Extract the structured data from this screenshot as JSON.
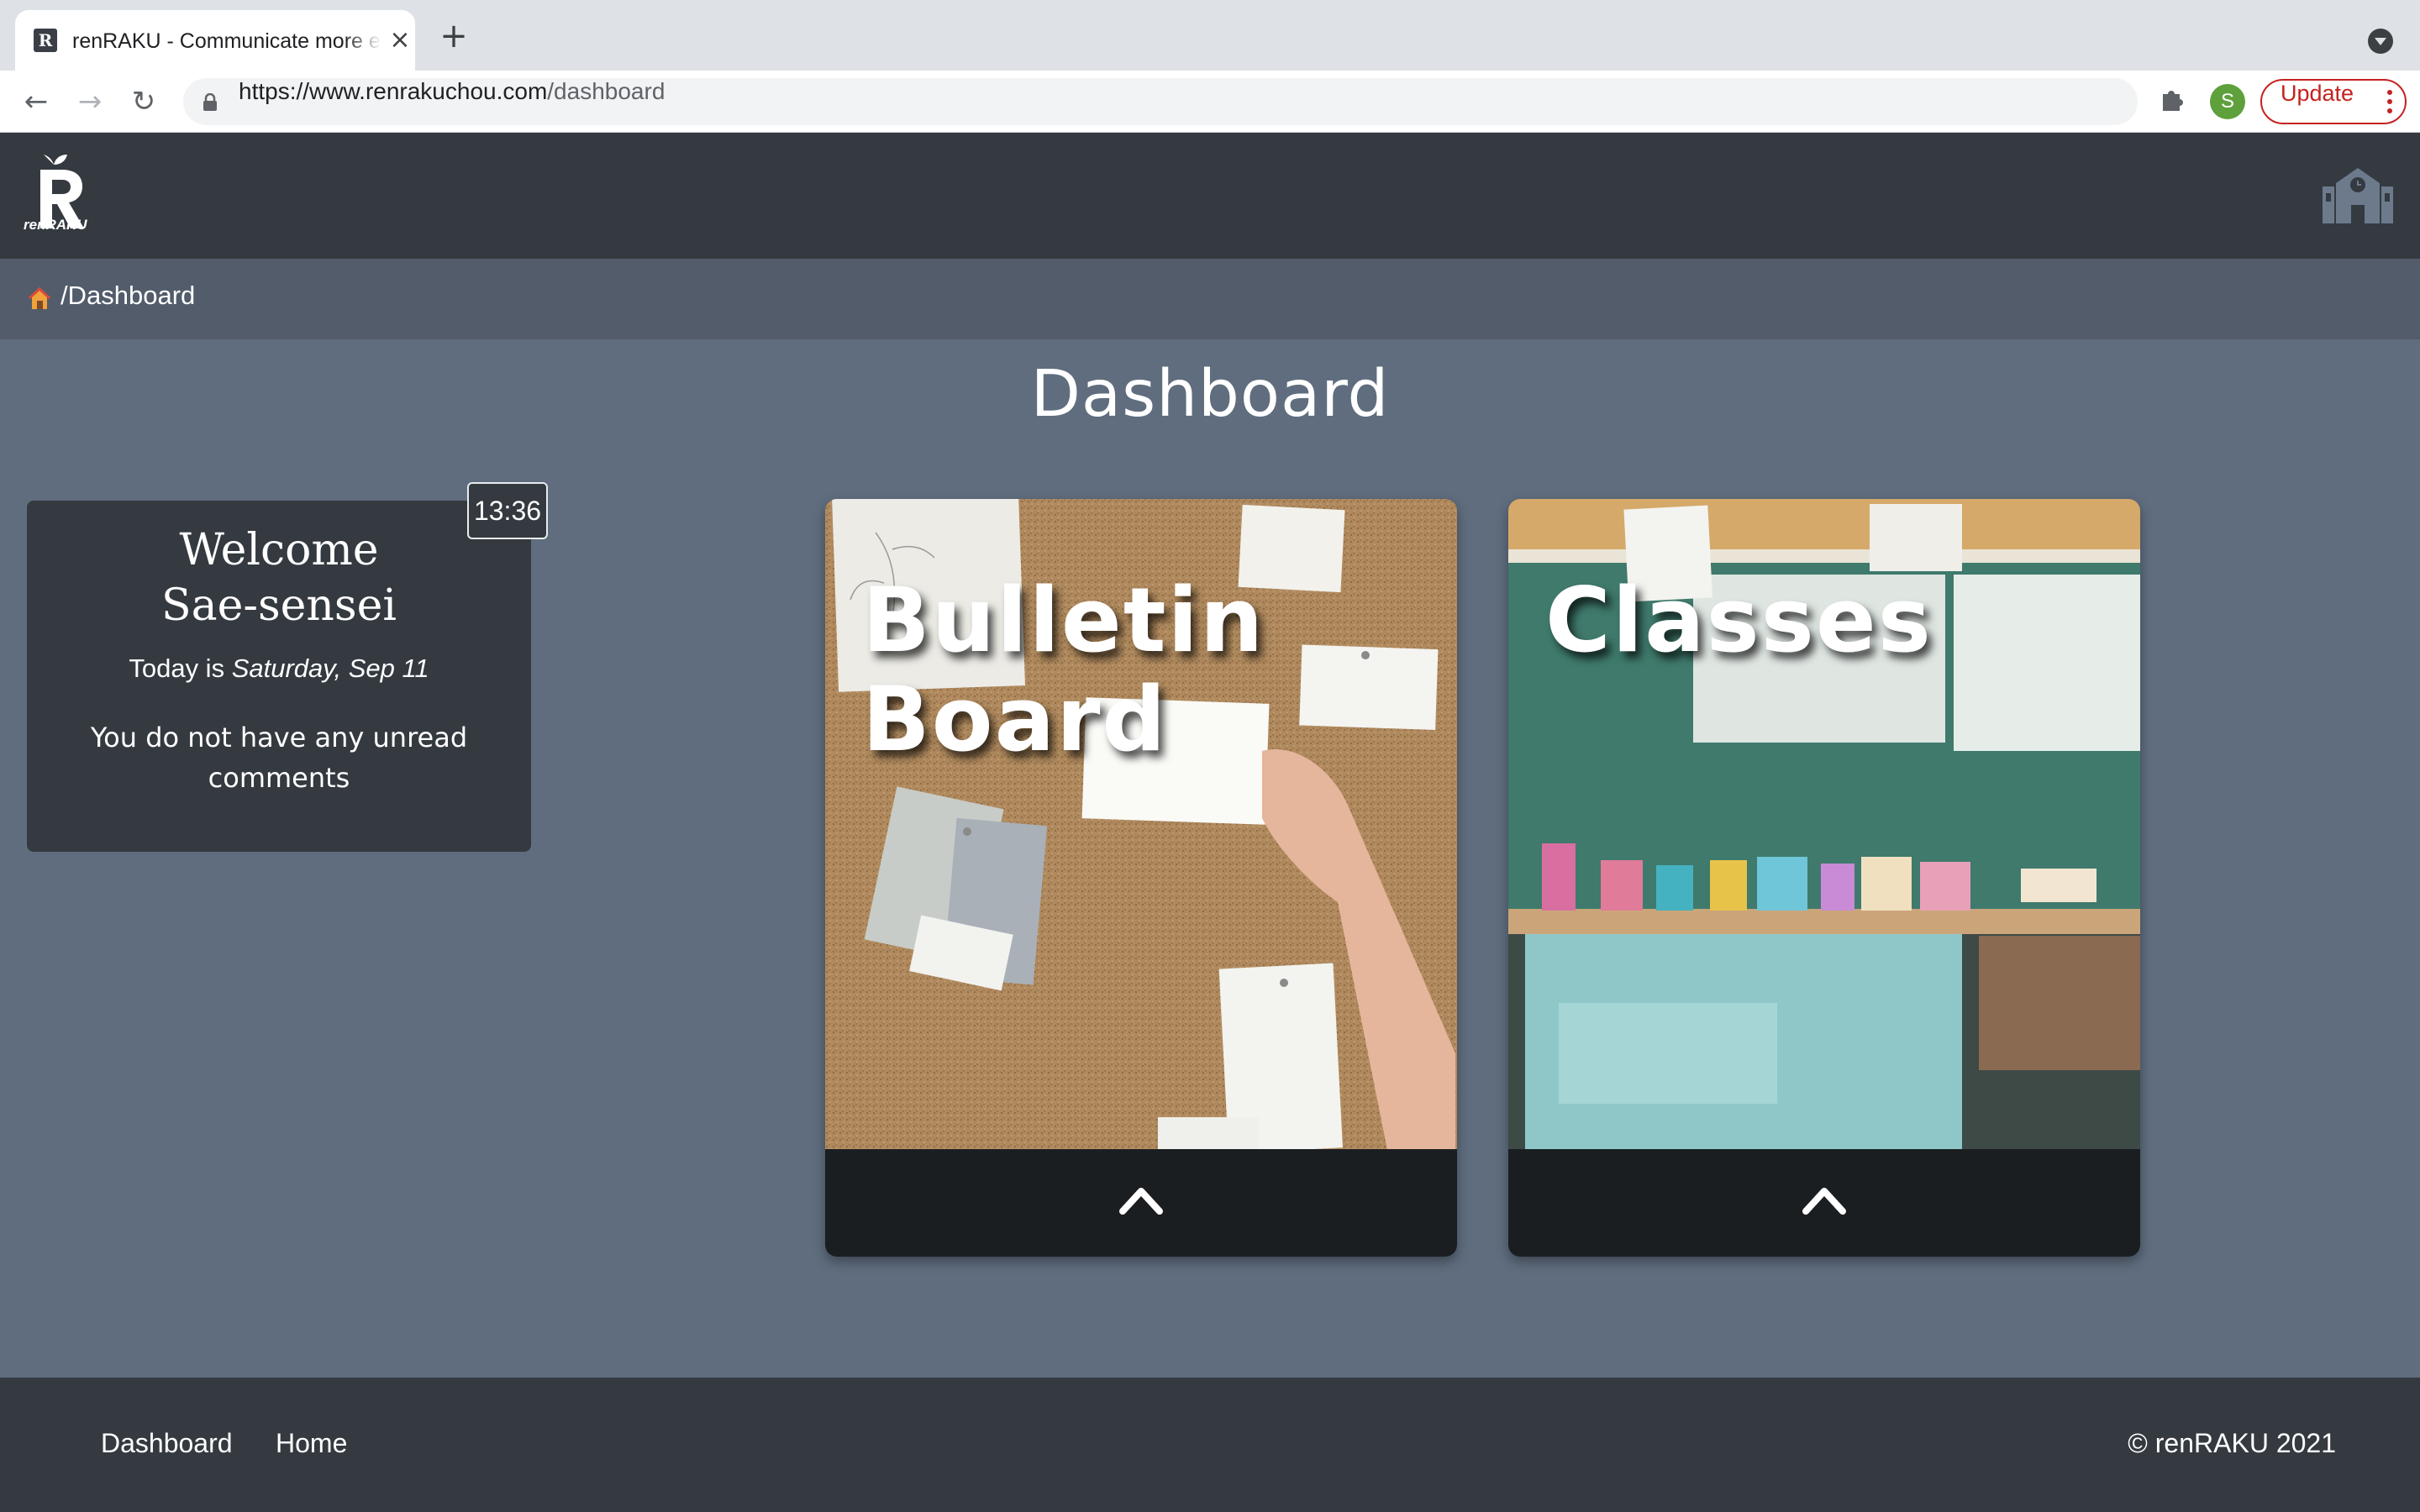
{
  "browser": {
    "tab_title": "renRAKU - Communicate more effectively",
    "tab_favicon": "R",
    "url_host": "https://www.renrakuchou.com",
    "url_path": "/dashboard",
    "profile_initial": "S",
    "update_label": "Update",
    "icons": [
      "back-icon",
      "forward-icon",
      "reload-icon",
      "lock-icon",
      "key-icon",
      "star-icon",
      "puzzle-icon",
      "kebab-icon"
    ]
  },
  "header": {
    "logo_text": "renRAKU",
    "school_icon": "school-icon"
  },
  "breadcrumb": {
    "path": "/Dashboard"
  },
  "main": {
    "title": "Dashboard",
    "welcome": {
      "title_line1": "Welcome",
      "title_line2": "Sae-sensei",
      "date_prefix": "Today is ",
      "date_value": "Saturday, Sep 11",
      "message": "You do not have any unread comments"
    },
    "clock": "13:36",
    "tiles": [
      {
        "title_line1": "Bulletin",
        "title_line2": "Board",
        "icon": "chevron-up-icon"
      },
      {
        "title_line1": "Classes",
        "title_line2": "",
        "icon": "chevron-up-icon"
      }
    ]
  },
  "footer": {
    "links": [
      "Dashboard",
      "Home"
    ],
    "copyright": "© renRAKU 2021"
  },
  "colors": {
    "page_bg": "#5f6d7e",
    "header_bg": "#343a40",
    "breadcrumb_bg": "#525c6a",
    "update_red": "#c5221f"
  }
}
